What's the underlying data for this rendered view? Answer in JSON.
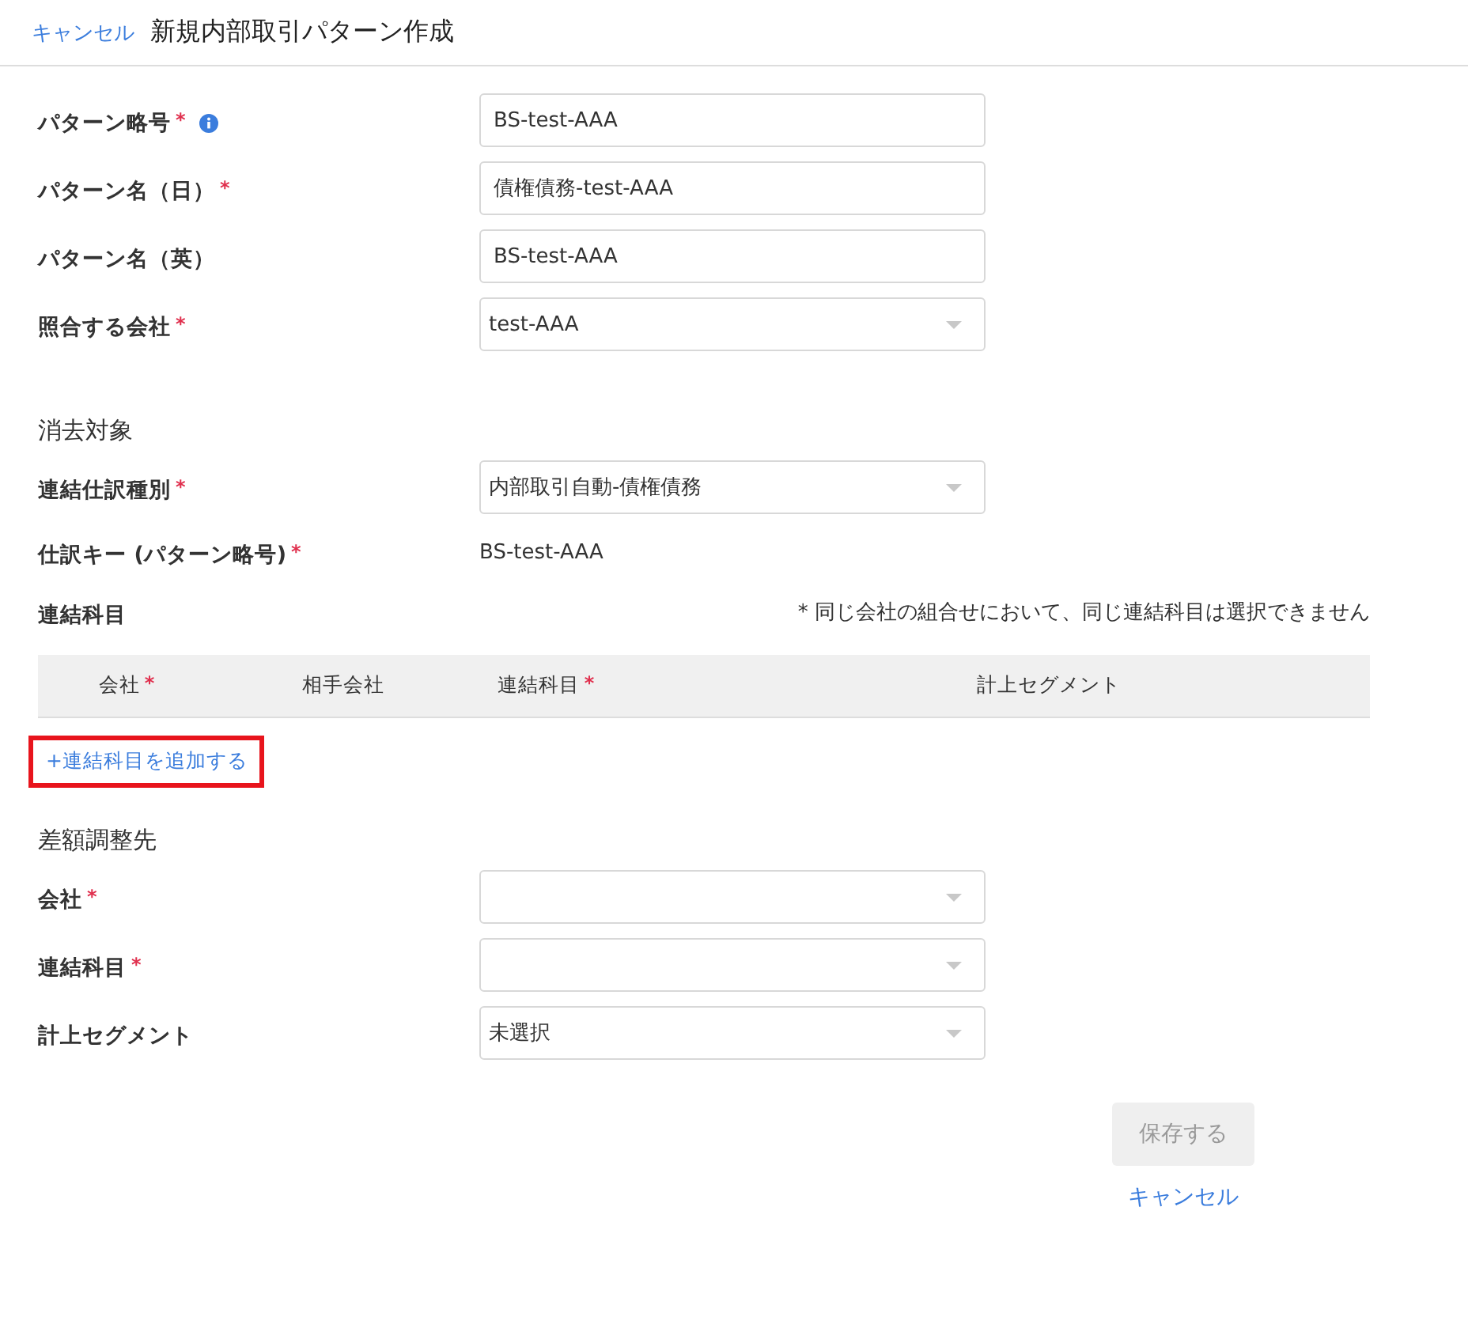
{
  "header": {
    "cancel_link": "キャンセル",
    "title": "新規内部取引パターン作成"
  },
  "sections": [
    {
      "fields": [
        {
          "kind": "text",
          "label": "パターン略号",
          "required_mark": "*",
          "info": true,
          "value": "BS-test-AAA"
        },
        {
          "kind": "text",
          "label": "パターン名（日）",
          "required_mark": "*",
          "value": "債権債務-test-AAA"
        },
        {
          "kind": "text",
          "label": "パターン名（英）",
          "value": "BS-test-AAA"
        },
        {
          "kind": "select",
          "label": "照合する会社",
          "required_mark": "*",
          "value": "test-AAA"
        }
      ]
    },
    {
      "heading": "消去対象",
      "fields": [
        {
          "kind": "select",
          "label": "連結仕訳種別",
          "required_mark": "*",
          "value": "内部取引自動-債権債務"
        },
        {
          "kind": "static",
          "label": "仕訳キー (パターン略号)",
          "required_mark": "*",
          "value": "BS-test-AAA"
        },
        {
          "kind": "table",
          "label": "連結科目",
          "note": "* 同じ会社の組合せにおいて、同じ連結科目は選択できません",
          "columns": [
            {
              "label": "会社",
              "required_mark": "*"
            },
            {
              "label": "相手会社"
            },
            {
              "label": "連結科目",
              "required_mark": "*"
            },
            {
              "label": "計上セグメント"
            }
          ],
          "add_link": {
            "label": "+連結科目を追加する",
            "highlighted": true
          }
        }
      ]
    },
    {
      "heading": "差額調整先",
      "fields": [
        {
          "kind": "select",
          "label": "会社",
          "required_mark": "*"
        },
        {
          "kind": "select",
          "label": "連結科目",
          "required_mark": "*"
        },
        {
          "kind": "select",
          "label": "計上セグメント",
          "value": "未選択"
        }
      ]
    }
  ],
  "footer": {
    "save_button": {
      "label": "保存する",
      "disabled": true
    },
    "cancel_link": "キャンセル"
  }
}
